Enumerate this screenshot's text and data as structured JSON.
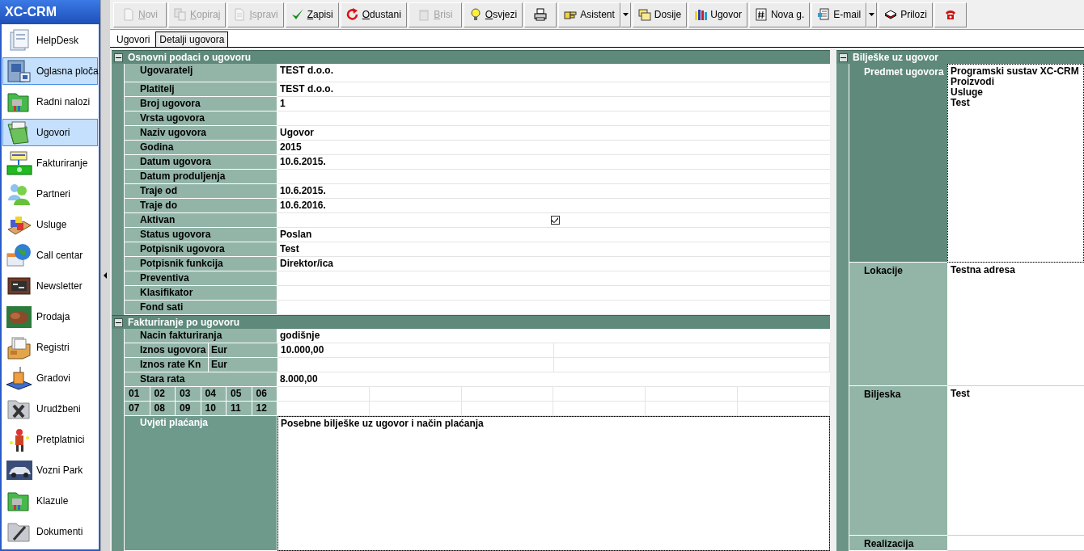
{
  "app_title": "XC-CRM",
  "sidebar": {
    "items": [
      {
        "label": "HelpDesk",
        "selected": false
      },
      {
        "label": "Oglasna ploča",
        "selected": true
      },
      {
        "label": "Radni nalozi",
        "selected": false
      },
      {
        "label": "Ugovori",
        "selected": true
      },
      {
        "label": "Fakturiranje",
        "selected": false
      },
      {
        "label": "Partneri",
        "selected": false
      },
      {
        "label": "Usluge",
        "selected": false
      },
      {
        "label": "Call centar",
        "selected": false
      },
      {
        "label": "Newsletter",
        "selected": false
      },
      {
        "label": "Prodaja",
        "selected": false
      },
      {
        "label": "Registri",
        "selected": false
      },
      {
        "label": "Gradovi",
        "selected": false
      },
      {
        "label": "Urudžbeni",
        "selected": false
      },
      {
        "label": "Pretplatnici",
        "selected": false
      },
      {
        "label": "Vozni Park",
        "selected": false
      },
      {
        "label": "Klazule",
        "selected": false
      },
      {
        "label": "Dokumenti",
        "selected": false
      }
    ]
  },
  "toolbar": [
    {
      "label": "Novi",
      "disabled": true,
      "underline_first": true
    },
    {
      "label": "Kopiraj",
      "disabled": true,
      "underline_first": true
    },
    {
      "label": "Ispravi",
      "disabled": true,
      "underline_first": true
    },
    {
      "label": "Zapisi",
      "disabled": false,
      "underline_first": true
    },
    {
      "label": "Odustani",
      "disabled": false,
      "underline_first": true
    },
    {
      "label": "Brisi",
      "disabled": true,
      "underline_first": true
    },
    {
      "label": "Osvjezi",
      "disabled": false,
      "underline_first": true
    },
    {
      "disabled": false
    },
    {
      "label": "Asistent",
      "disabled": false,
      "dropdown": true
    },
    {
      "label": "Dosije",
      "disabled": false
    },
    {
      "label": "Ugovor",
      "disabled": false
    },
    {
      "label": "Nova g.",
      "disabled": false
    },
    {
      "label": "E-mail",
      "disabled": false,
      "dropdown": true
    },
    {
      "label": "Prilozi",
      "disabled": false
    },
    {
      "disabled": false
    }
  ],
  "tabs": [
    {
      "label": "Ugovori",
      "selected": false
    },
    {
      "label": "Detalji ugovora",
      "selected": true
    }
  ],
  "basic": {
    "title": "Osnovni podaci o ugovoru",
    "expanded": true,
    "rows": [
      {
        "label": "Ugovaratelj",
        "value": "TEST d.o.o."
      },
      {
        "label": "Platitelj",
        "value": "TEST d.o.o."
      },
      {
        "label": "Broj ugovora",
        "value": "1"
      },
      {
        "label": "Vrsta ugovora"
      },
      {
        "label": "Naziv ugovora",
        "value": "Ugovor"
      },
      {
        "label": "Godina",
        "value": "2015"
      },
      {
        "label": "Datum ugovora",
        "value": "10.6.2015."
      },
      {
        "label": "Datum produljenja"
      },
      {
        "label": "Traje od",
        "value": "10.6.2015."
      },
      {
        "label": "Traje do",
        "value": "10.6.2016."
      },
      {
        "label": "Aktivan",
        "kind": "checkbox",
        "checked": true
      },
      {
        "label": "Status ugovora",
        "value": "Poslan"
      },
      {
        "label": "Potpisnik ugovora",
        "value": "Test"
      },
      {
        "label": "Potpisnik funkcija",
        "value": "Direktor/ica"
      },
      {
        "label": "Preventiva"
      },
      {
        "label": "Klasifikator"
      },
      {
        "label": "Fond sati"
      }
    ]
  },
  "billing": {
    "title": "Fakturiranje po ugovoru",
    "expanded": true,
    "rows": [
      {
        "kind": "text",
        "label": "Nacin fakturiranja",
        "value": "godišnje"
      },
      {
        "kind": "currency",
        "label": "Iznos ugovora",
        "unit": "Eur",
        "value": "10.000,00"
      },
      {
        "kind": "currency",
        "label": "Iznos rate Kn",
        "unit": "Eur"
      },
      {
        "kind": "text",
        "label": "Stara rata",
        "value": "8.000,00"
      },
      {
        "kind": "months",
        "cells": [
          "01",
          "02",
          "03",
          "04",
          "05",
          "06"
        ]
      },
      {
        "kind": "months",
        "cells": [
          "07",
          "08",
          "09",
          "10",
          "11",
          "12"
        ]
      },
      {
        "kind": "memo",
        "label": "Uvjeti plaćanja",
        "value": "Posebne bilješke uz ugovor i način plaćanja",
        "focused": true
      }
    ]
  },
  "notes": {
    "title": "Bilješke uz ugovor",
    "expanded": true,
    "rows": [
      {
        "label": "Predmet ugovora",
        "lines": [
          "Programski sustav XC-CRM",
          "Proizvodi",
          "Usluge",
          "Test"
        ],
        "focused": true
      },
      {
        "label": "Lokacije",
        "lines": [
          "Testna adresa"
        ],
        "focused": false
      },
      {
        "label": "Biljeska",
        "lines": [
          "Test"
        ],
        "focused": false
      },
      {
        "label": "Realizacija",
        "focused": false
      }
    ]
  }
}
